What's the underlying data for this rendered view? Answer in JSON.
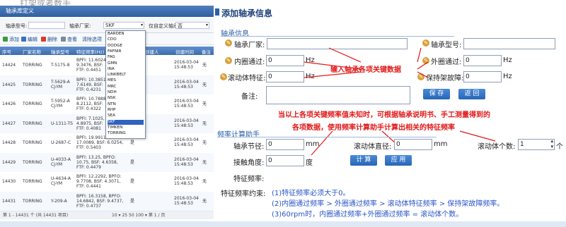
{
  "left": {
    "caption": "打架或者数手",
    "window_title": "轴承库定义",
    "search": {
      "model_label": "轴承型号:",
      "brand_label": "轴承厂家:",
      "brand_value": "SKF",
      "custom_label": "仅自定义轴承:",
      "custom_value": "否"
    },
    "toolbar": {
      "add": "添加",
      "edit": "编辑",
      "delete": "删除",
      "view": "查看",
      "clear": "清除选项"
    },
    "columns": [
      "序号",
      "厂家名称",
      "轴承型号",
      "特征频率(Hz)",
      "",
      "创建人",
      "创建时间",
      "备注"
    ],
    "rows": [
      {
        "id": "14424",
        "brand": "TORRING",
        "model": "T-5175-8",
        "freq": [
          "BPFI: 11.6024,",
          "9.3476,  BSF:",
          "FTF: 0.4451"
        ],
        "flag": "",
        "date": "2016-03-04",
        "time": "15:48:53",
        "note": "无"
      },
      {
        "id": "14425",
        "brand": "TORRING",
        "model": "T-5629-A",
        "model2": "CJ-YM",
        "freq": [
          "BPFI: 10.3851,",
          "7.6149,  BSF:",
          "FTF: 0.4231"
        ],
        "flag": "",
        "date": "2016-03-04",
        "time": "15:48:53",
        "note": "无"
      },
      {
        "id": "14426",
        "brand": "TORRING",
        "model": "T-5952-A",
        "model2": "CJ-YM",
        "freq": [
          "BPFI: 10.7888,",
          "8.2112,  BSF:",
          "FTF: 0.4322"
        ],
        "flag": "",
        "date": "2016-03-04",
        "time": "15:48:53",
        "note": "无"
      },
      {
        "id": "14427",
        "brand": "TORRING",
        "model": "U-1311-TS",
        "freq": [
          "BPFI: 7.1025,",
          "4.8975,  BSF:",
          "FTF: 0.4081"
        ],
        "flag": "",
        "date": "2016-03-04",
        "time": "15:48:53",
        "note": "无"
      },
      {
        "id": "14428",
        "brand": "TORRING",
        "model": "U-2687-C",
        "freq": [
          "BPFI: 19.9911,",
          "17.0089,  BSF: 6.0254,",
          "FTF: 0.5403"
        ],
        "flag": "是",
        "date": "2016-03-04",
        "time": "15:48:53",
        "note": "无"
      },
      {
        "id": "14429",
        "brand": "TORRING",
        "model": "U-4033-A",
        "model2": "CJ-YM",
        "freq": [
          "BPFI: 13.25,  BPFO:",
          "10.75,  BSF: 4.6358,",
          "FTF: 0.4479"
        ],
        "flag": "是",
        "date": "2016-03-04",
        "time": "15:48:53",
        "note": "无"
      },
      {
        "id": "14430",
        "brand": "TORRING",
        "model": "U-4634-A",
        "model2": "CJ-YM",
        "freq": [
          "BPFI: 12.2292,  BPFO:",
          "9.7708,  BSF: 4.3071,",
          "FTF: 0.4441"
        ],
        "flag": "是",
        "date": "2016-03-04",
        "time": "15:48:53",
        "note": "无"
      },
      {
        "id": "14431",
        "brand": "TORRING",
        "model": "Y-209-A",
        "freq": [
          "BPFI: 16.3158,  BPFO:",
          "14.6842,  BSF: 9.4737,",
          "FTF: 0.4737"
        ],
        "flag": "是",
        "date": "2016-03-04",
        "time": "15:48:53",
        "note": "无"
      }
    ],
    "footer": {
      "range": "第 1 - 14431 个 (共 14431 项目)",
      "page_info": "10 ▾  25  50  100  ▾  第 1 / 页"
    },
    "dropdown": [
      "BARDEN",
      "CDO",
      "DODGE",
      "FAFNIR",
      "FAG",
      "GMN",
      "INA",
      "LINKBELT",
      "MES",
      "MRC",
      "NDH",
      "NSK",
      "NTN",
      "RHP",
      "SEA",
      "SKF",
      "TIMKEN",
      "TORRING"
    ],
    "dropdown_selected": "SKF"
  },
  "form": {
    "title": "添加轴承信息",
    "section_info": "轴承信息",
    "brand_label": "轴承厂家:",
    "model_label": "轴承型号:",
    "inner_label": "内圈通过:",
    "outer_label": "外圈通过:",
    "roll_label": "滚动体特征:",
    "cage_label": "保持架故障:",
    "remark_label": "备注:",
    "unit_hz": "Hz",
    "save": "保 存",
    "back": "返 回",
    "ann_input": "输入轴承各项关键数据",
    "ann_unknown_1": "当以上各项关键频率值未知时，可根据轴承说明书、手工测量得到的",
    "ann_unknown_2": "各项数据，使用频率计算助手计算出相关的特征频率",
    "section_calc": "频率计算助手",
    "pitch_label": "轴承节径:",
    "roll_dia_label": "滚动体直径:",
    "roll_count_label": "滚动体个数:",
    "roll_count_value": "1",
    "roll_count_unit": "个",
    "unit_mm": "mm",
    "angle_label": "接触角度:",
    "angle_value": "0",
    "unit_deg": "度",
    "calc_btn": "计 算",
    "apply_btn": "应 用",
    "char_freq_label": "特征频率:",
    "constraint_label": "特征频率约束:",
    "constraint_1": "(1)特征频率必须大于0。",
    "constraint_2": "(2)内圈通过频率 > 外圈通过频率 > 滚动体特征频率 > 保持架故障频率。",
    "constraint_3": "(3)60rpm时，内圈通过频率+外圈通过频率 = 滚动体个数。",
    "inner_value": "0",
    "outer_value": "0",
    "roll_value": "0",
    "cage_value": "0",
    "pitch_value": "0",
    "roll_dia_value": "0"
  }
}
